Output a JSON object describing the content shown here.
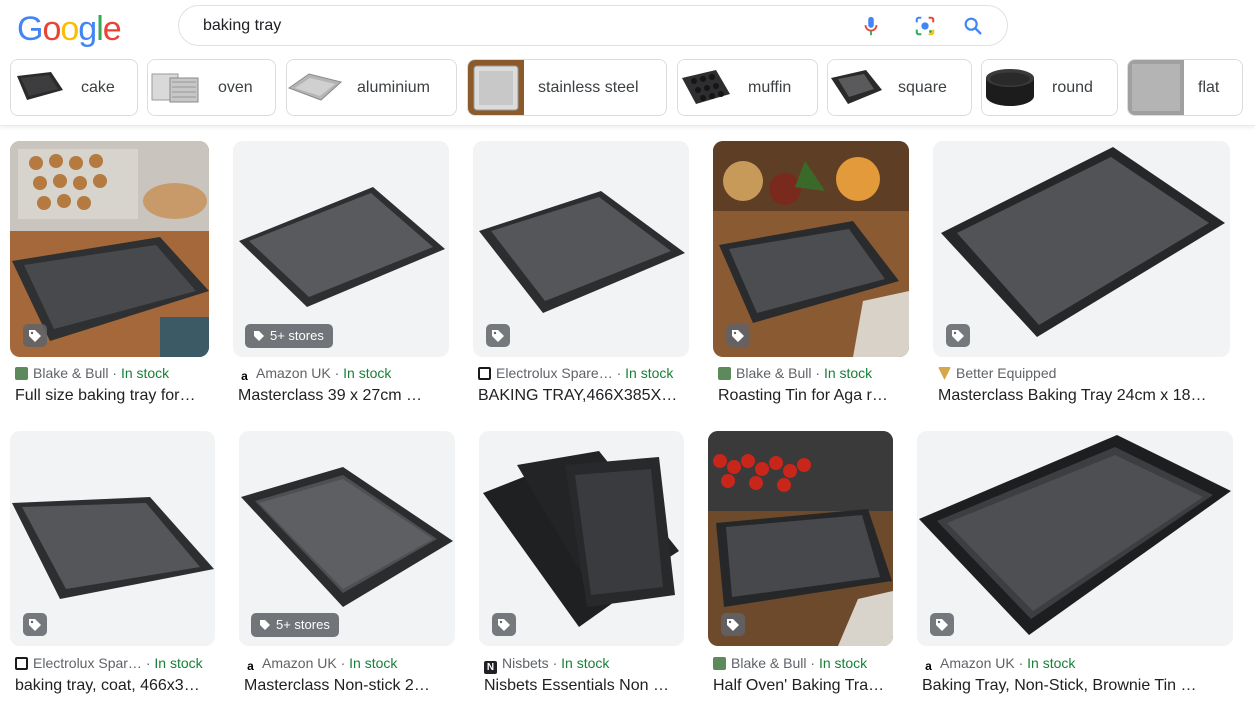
{
  "search": {
    "query": "baking tray"
  },
  "header": {
    "logo_text": "Google"
  },
  "colors": {
    "in_stock": "#188038",
    "link_text": "#202124",
    "meta_text": "#5f6368"
  },
  "chips": [
    {
      "label": "cake"
    },
    {
      "label": "oven"
    },
    {
      "label": "aluminium"
    },
    {
      "label": "stainless steel"
    },
    {
      "label": "muffin"
    },
    {
      "label": "square"
    },
    {
      "label": "round"
    },
    {
      "label": "flat"
    }
  ],
  "results": [
    {
      "source": "Blake & Bull",
      "sep": " · ",
      "stock": "In stock",
      "title": "Full size baking tray for…"
    },
    {
      "source": "Amazon UK",
      "sep": " · ",
      "stock": "In stock",
      "title": "Masterclass 39 x 27cm …",
      "badge": "5+ stores"
    },
    {
      "source": "Electrolux Spare…",
      "sep": " · ",
      "stock": "In stock",
      "title": "BAKING TRAY,466X385X…"
    },
    {
      "source": "Blake & Bull",
      "sep": " · ",
      "stock": "In stock",
      "title": "Roasting Tin for Aga r…"
    },
    {
      "source": "Better Equipped",
      "sep": "",
      "stock": "",
      "title": "Masterclass Baking Tray 24cm x 18…"
    },
    {
      "source": "Electrolux Spar…",
      "sep": " · ",
      "stock": "In stock",
      "title": "baking tray, coat, 466x3…"
    },
    {
      "source": "Amazon UK",
      "sep": " · ",
      "stock": "In stock",
      "title": "Masterclass Non-stick 2…",
      "badge": "5+ stores"
    },
    {
      "source": "Nisbets",
      "sep": " · ",
      "stock": "In stock",
      "title": "Nisbets Essentials Non …"
    },
    {
      "source": "Blake & Bull",
      "sep": " · ",
      "stock": "In stock",
      "title": "Half Oven' Baking Tra…"
    },
    {
      "source": "Amazon UK",
      "sep": " · ",
      "stock": "In stock",
      "title": "Baking Tray, Non-Stick, Brownie Tin …"
    }
  ]
}
